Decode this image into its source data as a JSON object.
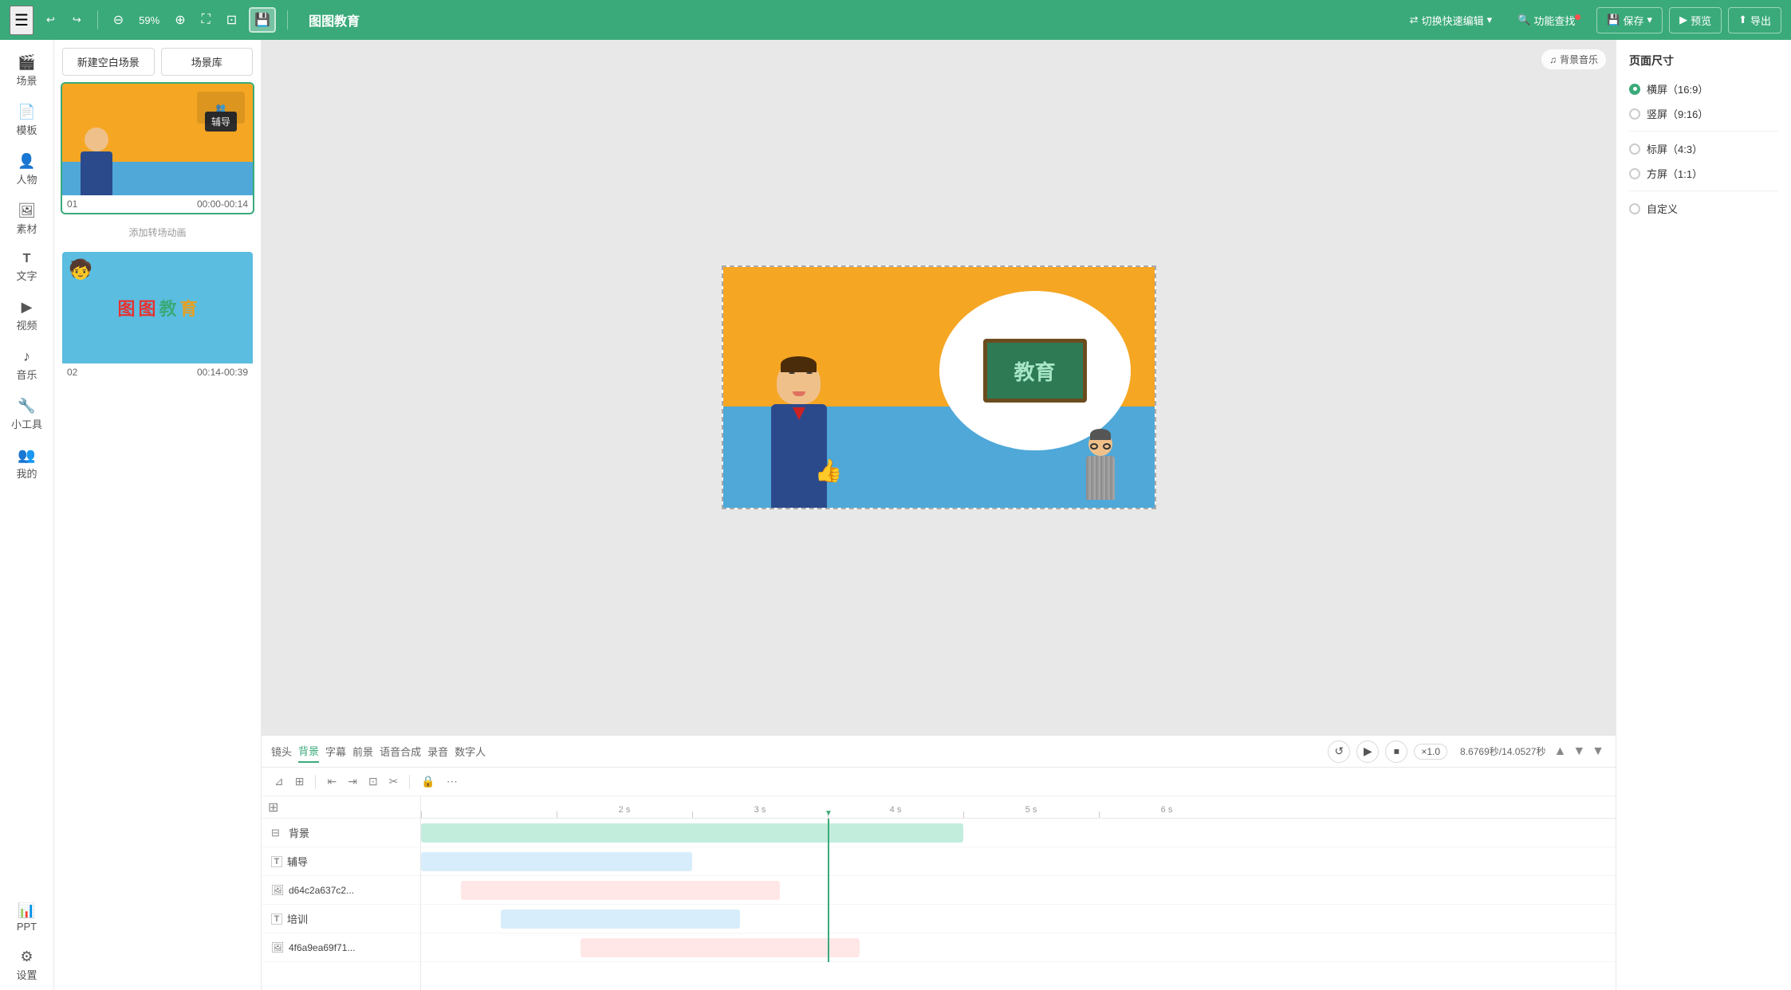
{
  "app": {
    "title": "图图教育"
  },
  "topbar": {
    "menu_icon": "☰",
    "undo": "↩",
    "redo": "↪",
    "zoom_out": "⊖",
    "zoom_level": "59%",
    "zoom_in": "⊕",
    "fullscreen": "⛶",
    "fit": "⊡",
    "save_icon": "💾",
    "switch_mode": "切换快速编辑",
    "feature_search": "功能查找",
    "save": "保存",
    "preview": "预览",
    "export": "导出",
    "arrow_down": "▾"
  },
  "sidebar": {
    "items": [
      {
        "id": "scene",
        "label": "场景",
        "icon": "🎬"
      },
      {
        "id": "template",
        "label": "模板",
        "icon": "📄"
      },
      {
        "id": "character",
        "label": "人物",
        "icon": "👤"
      },
      {
        "id": "material",
        "label": "素材",
        "icon": "🖼"
      },
      {
        "id": "text",
        "label": "文字",
        "icon": "T"
      },
      {
        "id": "video",
        "label": "视频",
        "icon": "▶"
      },
      {
        "id": "music",
        "label": "音乐",
        "icon": "♪"
      },
      {
        "id": "tools",
        "label": "小工具",
        "icon": "🔧"
      },
      {
        "id": "mine",
        "label": "我的",
        "icon": "👥"
      },
      {
        "id": "ppt",
        "label": "PPT",
        "icon": "📊"
      },
      {
        "id": "settings",
        "label": "设置",
        "icon": "⚙"
      }
    ]
  },
  "scene_panel": {
    "new_blank_btn": "新建空白场景",
    "scene_library_btn": "场景库",
    "add_transition": "添加转场动画",
    "scenes": [
      {
        "id": "01",
        "time": "00:00-00:14"
      },
      {
        "id": "02",
        "time": "00:14-00:39"
      }
    ]
  },
  "canvas": {
    "bg_music_label": "背景音乐",
    "bg_music_icon": "♫"
  },
  "timeline": {
    "tabs": [
      {
        "id": "lens",
        "label": "镜头"
      },
      {
        "id": "bg",
        "label": "背景"
      },
      {
        "id": "subtitle",
        "label": "字幕"
      },
      {
        "id": "foreground",
        "label": "前景"
      },
      {
        "id": "tts",
        "label": "语音合成"
      },
      {
        "id": "record",
        "label": "录音"
      },
      {
        "id": "digital",
        "label": "数字人"
      }
    ],
    "active_tab": "bg",
    "controls": {
      "replay": "↺",
      "play": "▶",
      "stop": "⏹",
      "speed": "×1.0"
    },
    "time_display": "8.6769秒/14.0527秒",
    "ruler_marks": [
      "2 s",
      "3 s",
      "4 s",
      "5 s",
      "6 s"
    ],
    "layers": [
      {
        "icon": "⊟",
        "label": "背景",
        "type": "bg"
      },
      {
        "icon": "T",
        "label": "辅导",
        "type": "text"
      },
      {
        "icon": "🖼",
        "label": "d64c2a637c2...",
        "type": "image"
      },
      {
        "icon": "T",
        "label": "培训",
        "type": "text"
      },
      {
        "icon": "🖼",
        "label": "4f6a9ea69f71...",
        "type": "image"
      }
    ],
    "toolbar_icons": [
      "⇅",
      "⊞",
      "⇤",
      "⇥",
      "⊡",
      "⊟",
      "↔",
      "≡",
      "⊘"
    ]
  },
  "right_panel": {
    "title": "页面尺寸",
    "options": [
      {
        "id": "landscape",
        "label": "横屏（16:9）",
        "checked": true
      },
      {
        "id": "portrait",
        "label": "竖屏（9:16）",
        "checked": false
      },
      {
        "id": "standard",
        "label": "标屏（4:3）",
        "checked": false
      },
      {
        "id": "square",
        "label": "方屏（1:1）",
        "checked": false
      },
      {
        "id": "custom",
        "label": "自定义",
        "checked": false
      }
    ]
  }
}
